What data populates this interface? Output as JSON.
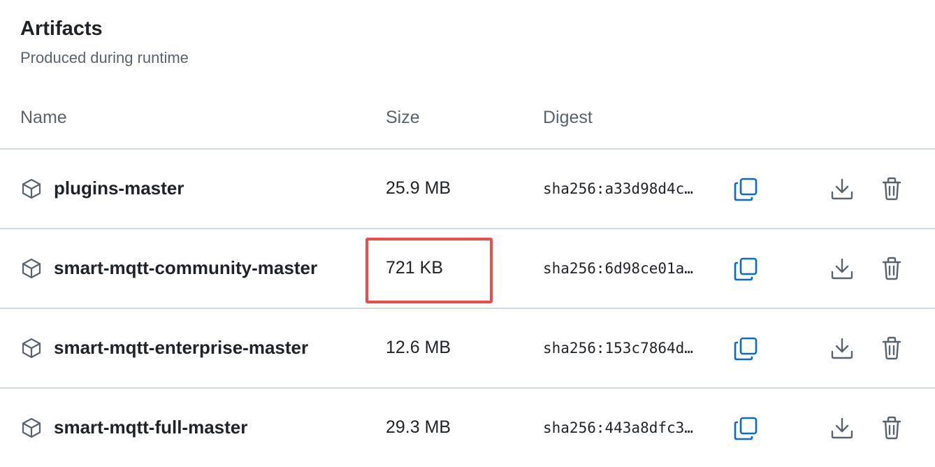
{
  "section": {
    "title": "Artifacts",
    "subtitle": "Produced during runtime"
  },
  "table": {
    "columns": {
      "name": "Name",
      "size": "Size",
      "digest": "Digest"
    },
    "rows": [
      {
        "name": "plugins-master",
        "size": "25.9 MB",
        "digest": "sha256:a33d98d4c…"
      },
      {
        "name": "smart-mqtt-community-master",
        "size": "721 KB",
        "digest": "sha256:6d98ce01a…"
      },
      {
        "name": "smart-mqtt-enterprise-master",
        "size": "12.6 MB",
        "digest": "sha256:153c7864d…"
      },
      {
        "name": "smart-mqtt-full-master",
        "size": "29.3 MB",
        "digest": "sha256:443a8dfc3…"
      }
    ]
  },
  "icons": {
    "row_icon": "package-icon",
    "copy": "copy-icon",
    "download": "download-icon",
    "delete": "trash-icon"
  },
  "colors": {
    "accent": "#0969da",
    "icon_gray": "#59636e",
    "highlight": "#f04a4a",
    "divider": "#d1d9e0"
  }
}
